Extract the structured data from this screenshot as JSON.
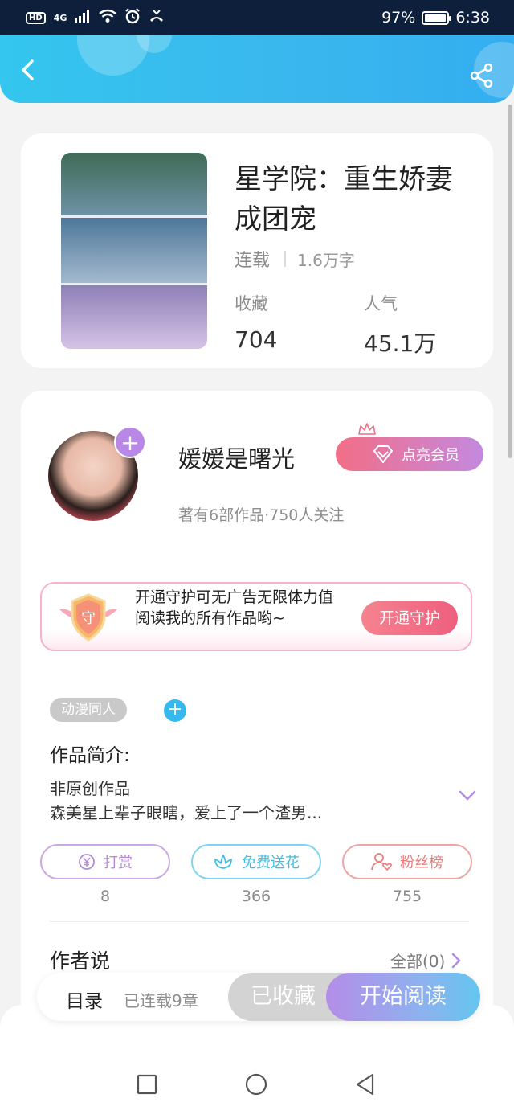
{
  "status_bar": {
    "network": "4G",
    "hd_badge": "HD",
    "battery_percent": "97%",
    "battery_level": 0.97,
    "time": "6:38"
  },
  "book": {
    "title": "星学院：重生娇妻成团宠",
    "status": "连载",
    "word_count": "1.6万字",
    "favorites_label": "收藏",
    "favorites_value": "704",
    "popularity_label": "人气",
    "popularity_value": "45.1万"
  },
  "author": {
    "name": "媛媛是曙光",
    "info": "著有6部作品·750人关注",
    "vip_button": "点亮会员"
  },
  "guard": {
    "icon_char": "守",
    "text": "开通守护可无广告无限体力值阅读我的所有作品哟~",
    "button": "开通守护"
  },
  "tags": [
    "动漫同人"
  ],
  "intro": {
    "title": "作品简介:",
    "line1": "非原创作品",
    "line2": "森美星上辈子眼瞎，爱上了一个渣男..."
  },
  "actions": [
    {
      "label": "打赏",
      "count": "8",
      "color": "#b58ad6",
      "icon": "yen-coin-icon"
    },
    {
      "label": "免费送花",
      "count": "366",
      "color": "#3bbfe8",
      "icon": "flower-icon"
    },
    {
      "label": "粉丝榜",
      "count": "755",
      "color": "#ee7c7c",
      "icon": "fan-user-icon"
    }
  ],
  "author_says": {
    "title": "作者说",
    "view_all": "全部(0)"
  },
  "bottom_bar": {
    "toc": "目录",
    "chapters": "已连载9章",
    "favorited": "已收藏",
    "start_reading": "开始阅读"
  }
}
